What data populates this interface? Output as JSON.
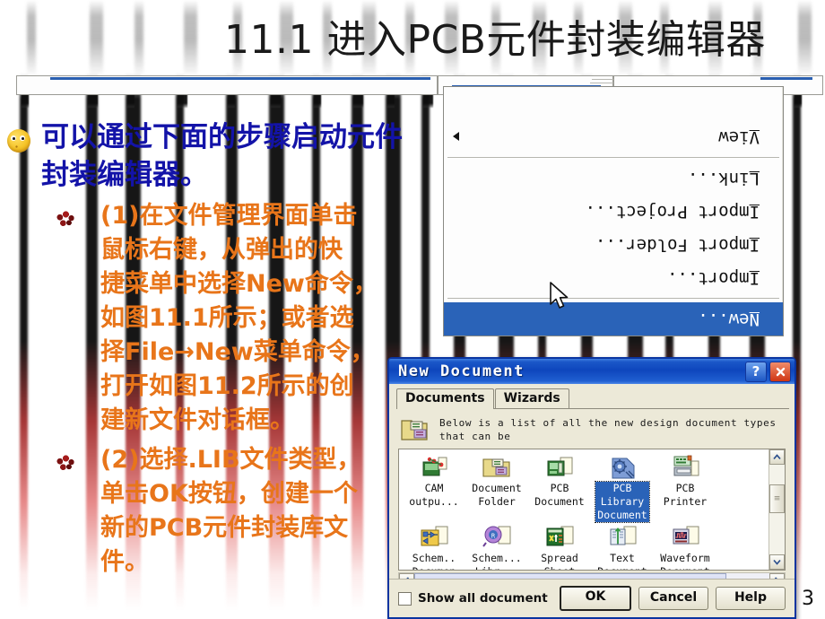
{
  "slide": {
    "title": "11.1  进入PCB元件封装编辑器",
    "page_number": "3",
    "colors": {
      "title_text": "#1a1a1a",
      "level1_text": "#1313A8",
      "level2_text": "#E8751A",
      "selection_blue": "#2a63b8",
      "dialog_titlebar": "#0e46bd",
      "dialog_face": "#ece9d8"
    }
  },
  "body": {
    "level1": [
      "可以通过下面的步骤启动元件封装编辑器。"
    ],
    "level2": [
      "(1)在文件管理界面单击鼠标右键，从弹出的快捷菜单中选择New命令，如图11.1所示；或者选择File→New菜单命令，打开如图11.2所示的创建新文件对话框。",
      "(2)选择.LIB文件类型，单击OK按钮，创建一个新的PCB元件封装库文件。"
    ],
    "level2_lines": {
      "item1": [
        "(1)在文件管理界面单击",
        "鼠标右键，从弹出的快",
        "捷菜单中选择New命令，",
        "如图11.1所示；或者选",
        "择File→New菜单命令，",
        "打开如图11.2所示的创",
        "建新文件对话框。"
      ],
      "item2": [
        "(2)选择.LIB文件类型，",
        "单击OK按钮，创建一个",
        "新的PCB元件封装库文",
        "件。"
      ]
    }
  },
  "context_menu": {
    "items": [
      {
        "label": "New...",
        "accel": "N",
        "selected": true,
        "submenu": false
      },
      {
        "separator": true
      },
      {
        "label": "Import...",
        "accel": "I",
        "selected": false,
        "submenu": false
      },
      {
        "label": "Import Folder...",
        "accel": "I",
        "selected": false,
        "submenu": false
      },
      {
        "label": "Import Project...",
        "accel": "I",
        "selected": false,
        "submenu": false
      },
      {
        "label": "Link...",
        "accel": "L",
        "selected": false,
        "submenu": false
      },
      {
        "separator": true
      },
      {
        "label": "View",
        "accel": "V",
        "selected": false,
        "submenu": true
      }
    ],
    "cursor": "arrow-pointer"
  },
  "dialog": {
    "title": "New Document",
    "titlebar_buttons": [
      {
        "name": "help-button",
        "glyph": "?"
      },
      {
        "name": "close-button",
        "glyph": "✕"
      }
    ],
    "tabs": [
      {
        "label": "Documents",
        "active": true
      },
      {
        "label": "Wizards",
        "active": false
      }
    ],
    "hint_icon": "folder-documents-icon",
    "hint_text": "Below is a list of all the new design document types\nthat can be",
    "documents": [
      {
        "label": "CAM\noutpu...",
        "icon": "cam-output-icon",
        "selected": false
      },
      {
        "label": "Document\nFolder",
        "icon": "document-folder-icon",
        "selected": false
      },
      {
        "label": "PCB\nDocument",
        "icon": "pcb-document-icon",
        "selected": false
      },
      {
        "label": "PCB\nLibrary\nDocument",
        "icon": "pcb-library-document-icon",
        "selected": true
      },
      {
        "label": "PCB\nPrinter",
        "icon": "pcb-printer-icon",
        "selected": false
      },
      {
        "label": "Schem..\nDocumen",
        "icon": "schematic-document-icon",
        "selected": false
      },
      {
        "label": "Schem...\nLibr...",
        "icon": "schematic-library-icon",
        "selected": false
      },
      {
        "label": "Spread\nSheet",
        "icon": "spreadsheet-icon",
        "selected": false
      },
      {
        "label": "Text\nDocument",
        "icon": "text-document-icon",
        "selected": false
      },
      {
        "label": "Waveform\nDocument",
        "icon": "waveform-document-icon",
        "selected": false
      }
    ],
    "scrollbars": {
      "vertical_up": "▲",
      "vertical_down": "▼",
      "horizontal_left": "◀",
      "horizontal_right": "▶"
    },
    "checkbox": {
      "label": "Show all document ki",
      "checked": false
    },
    "buttons": [
      {
        "label": "OK",
        "default": true
      },
      {
        "label": "Cancel",
        "default": false
      },
      {
        "label": "Help",
        "default": false
      }
    ]
  }
}
